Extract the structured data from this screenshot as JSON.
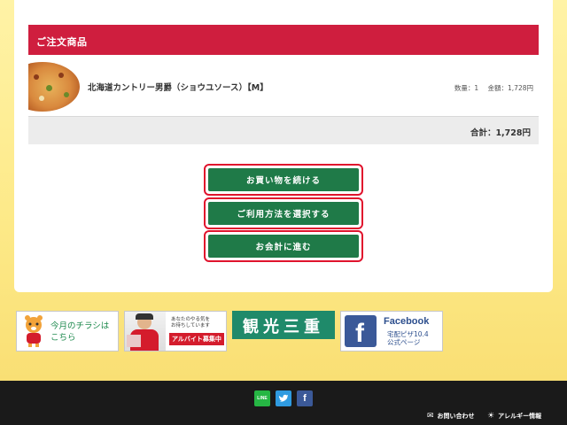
{
  "section": {
    "title": "ご注文商品"
  },
  "item": {
    "name": "北海道カントリー男爵（ショウユソース）【M】",
    "quantity": "数量：1",
    "amount": "金額：1,728円"
  },
  "total": {
    "text": "合計：1,728円"
  },
  "buttons": {
    "continue_shopping": "お買い物を続ける",
    "choose_method": "ご利用方法を選択する",
    "checkout": "お会計に進む"
  },
  "banners": {
    "flyer": {
      "line1": "今月のチラシは",
      "line2": "こちら"
    },
    "recruit": {
      "line1": "あなたのやる気を",
      "line2": "お待ちしています",
      "badge": "アルバイト募集中"
    },
    "tourism": {
      "text": "観光三重"
    },
    "facebook": {
      "title": "Facebook",
      "line1": "宅配ピザ10.4",
      "line2": "公式ページ"
    }
  },
  "footer": {
    "contact": "お問い合わせ",
    "allergy": "アレルギー情報"
  },
  "colors": {
    "accent_red": "#cf1e3e",
    "button_green": "#1f7a48",
    "highlight_border": "#e0132d",
    "background_yellow": "#fbe98e"
  }
}
